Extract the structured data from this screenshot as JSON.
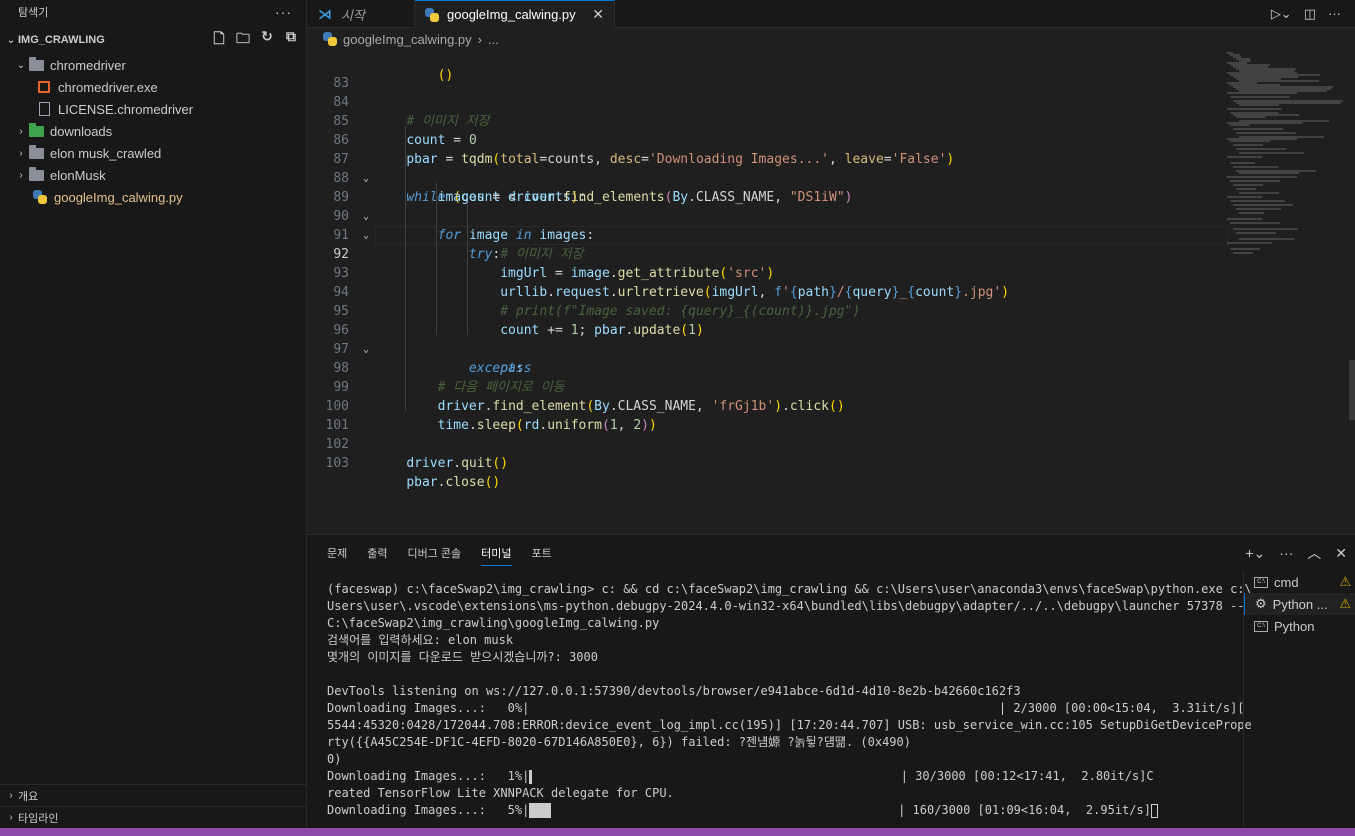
{
  "sidebar": {
    "title": "탐색기",
    "more": "···",
    "section": "IMG_CRAWLING",
    "items": [
      {
        "label": "chromedriver"
      },
      {
        "label": "chromedriver.exe"
      },
      {
        "label": "LICENSE.chromedriver"
      },
      {
        "label": "downloads"
      },
      {
        "label": "elon musk_crawled"
      },
      {
        "label": "elonMusk"
      },
      {
        "label": "googleImg_calwing.py"
      }
    ],
    "outline": "개요",
    "timeline": "타임라인"
  },
  "tabs": {
    "welcome": "시작",
    "active": "googleImg_calwing.py"
  },
  "breadcrumb": {
    "file": "googleImg_calwing.py",
    "more": "..."
  },
  "editor": {
    "line_numbers": [
      "83",
      "84",
      "85",
      "86",
      "87",
      "88",
      "89",
      "90",
      "91",
      "92",
      "93",
      "94",
      "95",
      "96",
      "97",
      "98",
      "99",
      "100",
      "101",
      "102",
      "103"
    ]
  },
  "panel": {
    "tabs": [
      "문제",
      "출력",
      "디버그 콘솔",
      "터미널",
      "포트"
    ],
    "terminals": [
      "cmd",
      "Python ...",
      "Python"
    ]
  },
  "terminal": {
    "lines": [
      "(faceswap) c:\\faceSwap2\\img_crawling> c: && cd c:\\faceSwap2\\img_crawling && c:\\Users\\user\\anaconda3\\envs\\faceSwap\\python.exe c:\\",
      "Users\\user\\.vscode\\extensions\\ms-python.debugpy-2024.4.0-win32-x64\\bundled\\libs\\debugpy\\adapter/../..\\debugpy\\launcher 57378 --",
      "C:\\faceSwap2\\img_crawling\\googleImg_calwing.py",
      "검색어를 입력하세요: elon musk",
      "몇개의 이미지를 다운로드 받으시겠습니까?: 3000",
      "",
      "DevTools listening on ws://127.0.0.1:57390/devtools/browser/e941abce-6d1d-4d10-8e2b-b42660c162f3",
      "Downloading Images...:   0%|                                                                 | 2/3000 [00:00<15:04,  3.31it/s][",
      "5544:45320:0428/172044.708:ERROR:device_event_log_impl.cc(195)] [17:20:44.707] USB: usb_service_win.cc:105 SetupDiGetDevicePrope",
      "rty({{A45C254E-DF1C-4EFD-8020-67D146A850E0}, 6}) failed: ?젠냼嫄 ?놁뒿?덈떎. (0x490)",
      "0)",
      "Downloading Images...:   1%|",
      "reated TensorFlow Lite XNNPACK delegate for CPU.",
      "Downloading Images...:   5%|"
    ],
    "line11_tail": "                                                   | 30/3000 [00:12<17:41,  2.80it/s]C",
    "line13_tail": "                                                | 160/3000 [01:09<16:04,  2.95it/s]"
  }
}
